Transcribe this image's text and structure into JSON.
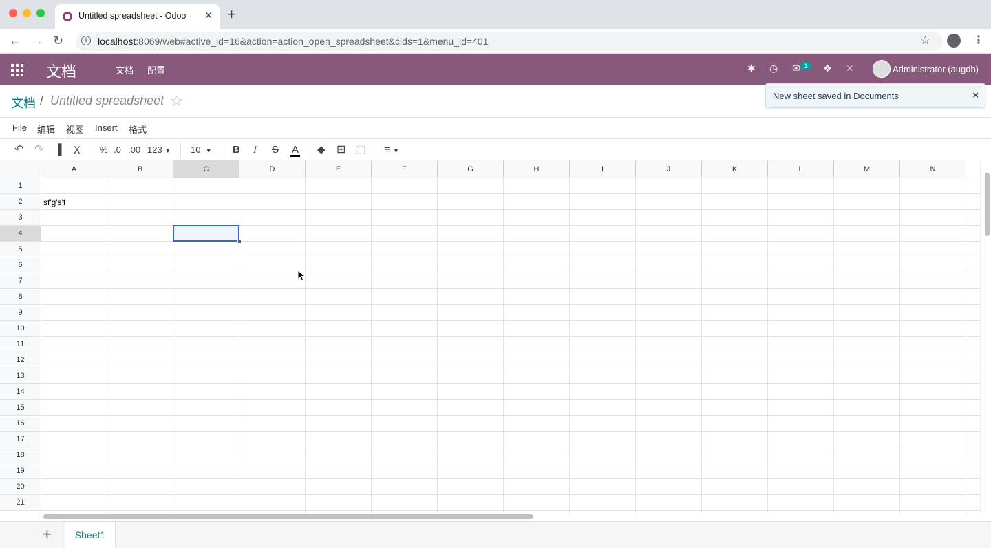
{
  "browser": {
    "tab_title": "Untitled spreadsheet - Odoo",
    "url_host": "localhost",
    "url_path": ":8069/web#active_id=16&action=action_open_spreadsheet&cids=1&menu_id=401"
  },
  "navbar": {
    "brand": "文档",
    "menu": [
      "文档",
      "配置"
    ],
    "chat_badge": "1",
    "user": "Administrator (augdb)"
  },
  "breadcrumb": {
    "root": "文档",
    "separator": "/",
    "current": "Untitled spreadsheet"
  },
  "toast": {
    "message": "New sheet saved in Documents"
  },
  "spreadsheet_menu": [
    "File",
    "编辑",
    "视图",
    "Insert",
    "格式"
  ],
  "toolbar": {
    "percent": "%",
    "decimal_less": ".0",
    "decimal_more": ".00",
    "number_format": "123",
    "font_size": "10",
    "bold": "B",
    "italic": "I",
    "strike": "S",
    "text_color": "A"
  },
  "grid": {
    "columns": [
      "A",
      "B",
      "C",
      "D",
      "E",
      "F",
      "G",
      "H",
      "I",
      "J",
      "K",
      "L",
      "M",
      "N"
    ],
    "rows": [
      "1",
      "2",
      "3",
      "4",
      "5",
      "6",
      "7",
      "8",
      "9",
      "10",
      "11",
      "12",
      "13",
      "14",
      "15",
      "16",
      "17",
      "18",
      "19",
      "20",
      "21"
    ],
    "selected_cell": "C4",
    "cells": {
      "A2": "sf'g's'f"
    }
  },
  "sheets": [
    "Sheet1"
  ],
  "colors": {
    "navbar": "#875a7b",
    "link": "#017e84",
    "selection": "#3266ca"
  }
}
